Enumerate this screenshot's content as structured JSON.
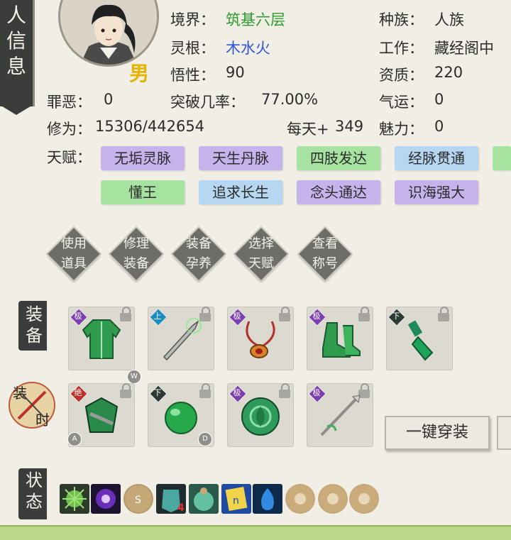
{
  "side_tab": {
    "text": "人信息"
  },
  "profile": {
    "gender": "男",
    "realm_label": "境界：",
    "realm_value": "筑基六层",
    "root_label": "灵根：",
    "root_value": "木水火",
    "comprehension_label": "悟性：",
    "comprehension_value": "90",
    "race_label": "种族：",
    "race_value": "人族",
    "job_label": "工作：",
    "job_value": "藏经阁中",
    "aptitude_label": "资质：",
    "aptitude_value": "220",
    "sin_label": "罪恶：",
    "sin_value": "0",
    "breakthrough_label": "突破几率：",
    "breakthrough_value": "77.00%",
    "luck_label": "气运：",
    "luck_value": "0",
    "cultivation_label": "修为：",
    "cultivation_value": "15306/442654",
    "daily_label": "每天+",
    "daily_value": "349",
    "charm_label": "魅力：",
    "charm_value": "0"
  },
  "talents": {
    "label": "天赋：",
    "row1": [
      "无垢灵脉",
      "天生丹脉",
      "四肢发达",
      "经脉贯通"
    ],
    "row2": [
      "懂王",
      "追求长生",
      "念头通达",
      "识海强大"
    ]
  },
  "actions": [
    {
      "line1": "使用",
      "line2": "道具"
    },
    {
      "line1": "修理",
      "line2": "装备"
    },
    {
      "line1": "装备",
      "line2": "孕养"
    },
    {
      "line1": "选择",
      "line2": "天赋"
    },
    {
      "line1": "查看",
      "line2": "称号"
    }
  ],
  "equipment": {
    "label": "装备",
    "row1_grades": [
      "极",
      "上",
      "极",
      "极",
      "下"
    ],
    "row2_grades": [
      "绝",
      "下",
      "极",
      "极"
    ],
    "keys": {
      "w": "W",
      "a": "A",
      "d": "D"
    },
    "equip_all": "一键穿装",
    "time_label_1": "装",
    "time_label_2": "时"
  },
  "status": {
    "label": "状态",
    "badge_number": "4"
  },
  "colors": {
    "grade_ji": "#7b3fb0",
    "grade_shang": "#1e8bc3",
    "grade_xia": "#2e3a34",
    "grade_jue": "#c0302a",
    "realm_green": "#2f9a2f",
    "root_blue": "#3157d8"
  }
}
